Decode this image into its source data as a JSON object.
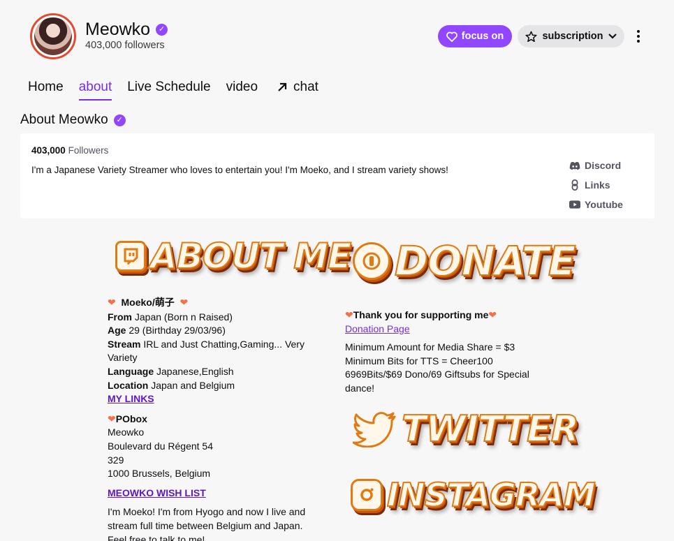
{
  "channel": {
    "name": "Meowko",
    "followers": "403,000 followers"
  },
  "header_buttons": {
    "focus_label": "focus on",
    "subscription_label": "subscription"
  },
  "tabs": [
    {
      "label": "Home"
    },
    {
      "label": "about"
    },
    {
      "label": "Live Schedule"
    },
    {
      "label": "video"
    },
    {
      "label": "chat"
    }
  ],
  "about": {
    "title": "About Meowko",
    "followers_count": "403,000",
    "followers_label": "Followers",
    "description": "I'm a Japanese Variety Streamer who loves to entertain you! I'm Moeko, and I stream variety shows!",
    "social": [
      {
        "label": "Discord",
        "icon": "discord-icon"
      },
      {
        "label": "Links",
        "icon": "link-icon"
      },
      {
        "label": "Youtube",
        "icon": "youtube-icon"
      }
    ]
  },
  "panels": {
    "about_me_banner": "ABOUT ME",
    "donate_banner": "DONATE",
    "twitter_banner": "TWITTER",
    "instagram_banner": "INSTAGRAM",
    "about_me": {
      "name_heading": "Moeko/萌子",
      "from_label": "From",
      "from_value": "Japan (Born n Raised)",
      "age_label": "Age",
      "age_value": "29 (Birthday 29/03/96)",
      "stream_label": "Stream",
      "stream_value": "IRL and Just Chatting,Gaming... Very Variety",
      "language_label": "Language",
      "language_value": "Japanese,English",
      "location_label": "Location",
      "location_value": "Japan and Belgium",
      "my_links": "MY LINKS",
      "pobox_heading": "PObox",
      "address": [
        "Meowko",
        "Boulevard du Régent 54",
        "329",
        "1000 Brussels, Belgium"
      ],
      "wish_list": "MEOWKO WISH LIST",
      "intro": "I'm Moeko! I'm from Hyogo and now I live and stream full time between Belgium and Japan. Feel free to talk to me!"
    },
    "donate": {
      "thanks": "Thank you for supporting me",
      "donation_page": "Donation Page",
      "lines": [
        "Minimum Amount for Media Share = $3",
        "Minimum Bits for TTS = Cheer100",
        "6969Bits/$69 Dono/69 Giftsubs for Special dance!"
      ]
    }
  },
  "colors": {
    "accent": "#9147ff",
    "accent_text": "#772ce8",
    "banner_orange": "#e07a12"
  }
}
